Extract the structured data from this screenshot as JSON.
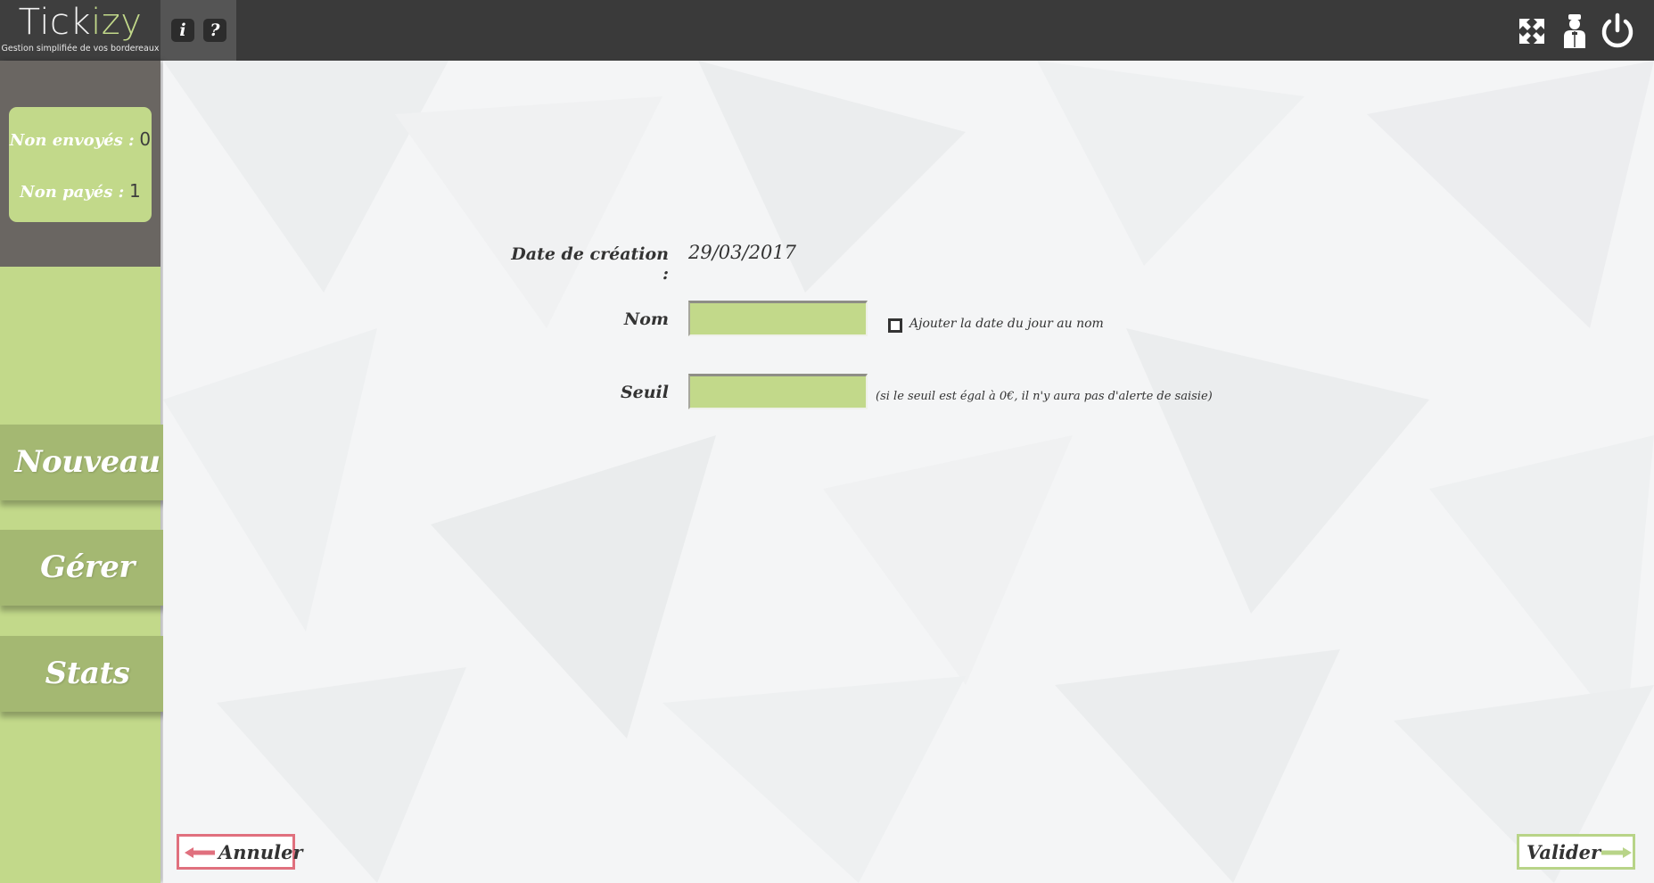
{
  "app": {
    "name_main": "Tick",
    "name_accent": "izy",
    "tagline": "Gestion simplifiée de vos bordereaux"
  },
  "toolbar": {
    "info_label": "i",
    "help_label": "?",
    "icons": [
      "fullscreen-icon",
      "user-icon",
      "power-icon"
    ]
  },
  "counters": {
    "unsent_label": "Non envoyés :",
    "unsent_value": "0",
    "unpaid_label": "Non payés :",
    "unpaid_value": "1"
  },
  "nav": {
    "new_label": "Nouveau",
    "manage_label": "Gérer",
    "stats_label": "Stats"
  },
  "form": {
    "creation_date_label": "Date de création :",
    "creation_date_value": "29/03/2017",
    "name_label": "Nom",
    "name_value": "",
    "add_date_checkbox_label": "Ajouter la date du jour au nom",
    "add_date_checked": false,
    "threshold_label": "Seuil",
    "threshold_value": "",
    "threshold_note": "(si le seuil est égal à 0€, il n'y aura pas d'alerte de saisie)"
  },
  "actions": {
    "cancel_label": "Annuler",
    "validate_label": "Valider"
  },
  "colors": {
    "accent_green": "#c2d98a",
    "nav_green": "#a4b872",
    "cancel_red": "#e0707e",
    "topbar": "#3a3a3a"
  }
}
